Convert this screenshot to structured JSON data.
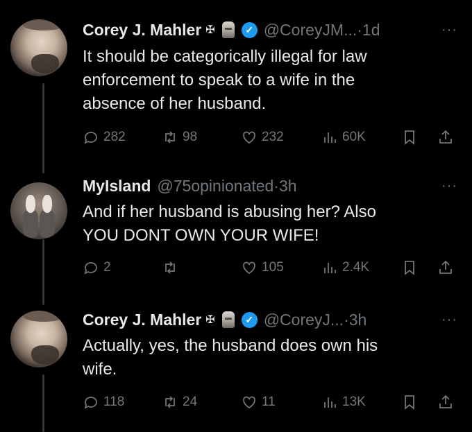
{
  "tweets": [
    {
      "name": "Corey J. Mahler",
      "badge_glyph": "✠",
      "handle": "@CoreyJM...",
      "sep": " · ",
      "time": "1d",
      "text": "It should be categorically illegal for law\nenforcement to speak to a wife in the\nabsence of her husband.",
      "replies": "282",
      "retweets": "98",
      "likes": "232",
      "views": "60K"
    },
    {
      "name": "MyIsland",
      "handle": "@75opinionated",
      "sep": " · ",
      "time": "3h",
      "text": "And if her husband is abusing her? Also\nYOU DONT OWN YOUR WIFE!",
      "replies": "2",
      "retweets": "",
      "likes": "105",
      "views": "2.4K"
    },
    {
      "name": "Corey J. Mahler",
      "badge_glyph": "✠",
      "handle": "@CoreyJ...",
      "sep": " · ",
      "time": "3h",
      "text": "Actually, yes, the husband does own his\nwife.",
      "replies": "118",
      "retweets": "24",
      "likes": "11",
      "views": "13K"
    }
  ],
  "more_glyph": "···",
  "colors": {
    "background": "#000000",
    "text": "#e7e9ea",
    "muted": "#71767b",
    "verified": "#1d9bf0"
  },
  "icons": [
    "reply-icon",
    "retweet-icon",
    "like-icon",
    "views-icon",
    "bookmark-icon",
    "share-icon",
    "verified-icon",
    "more-icon"
  ]
}
